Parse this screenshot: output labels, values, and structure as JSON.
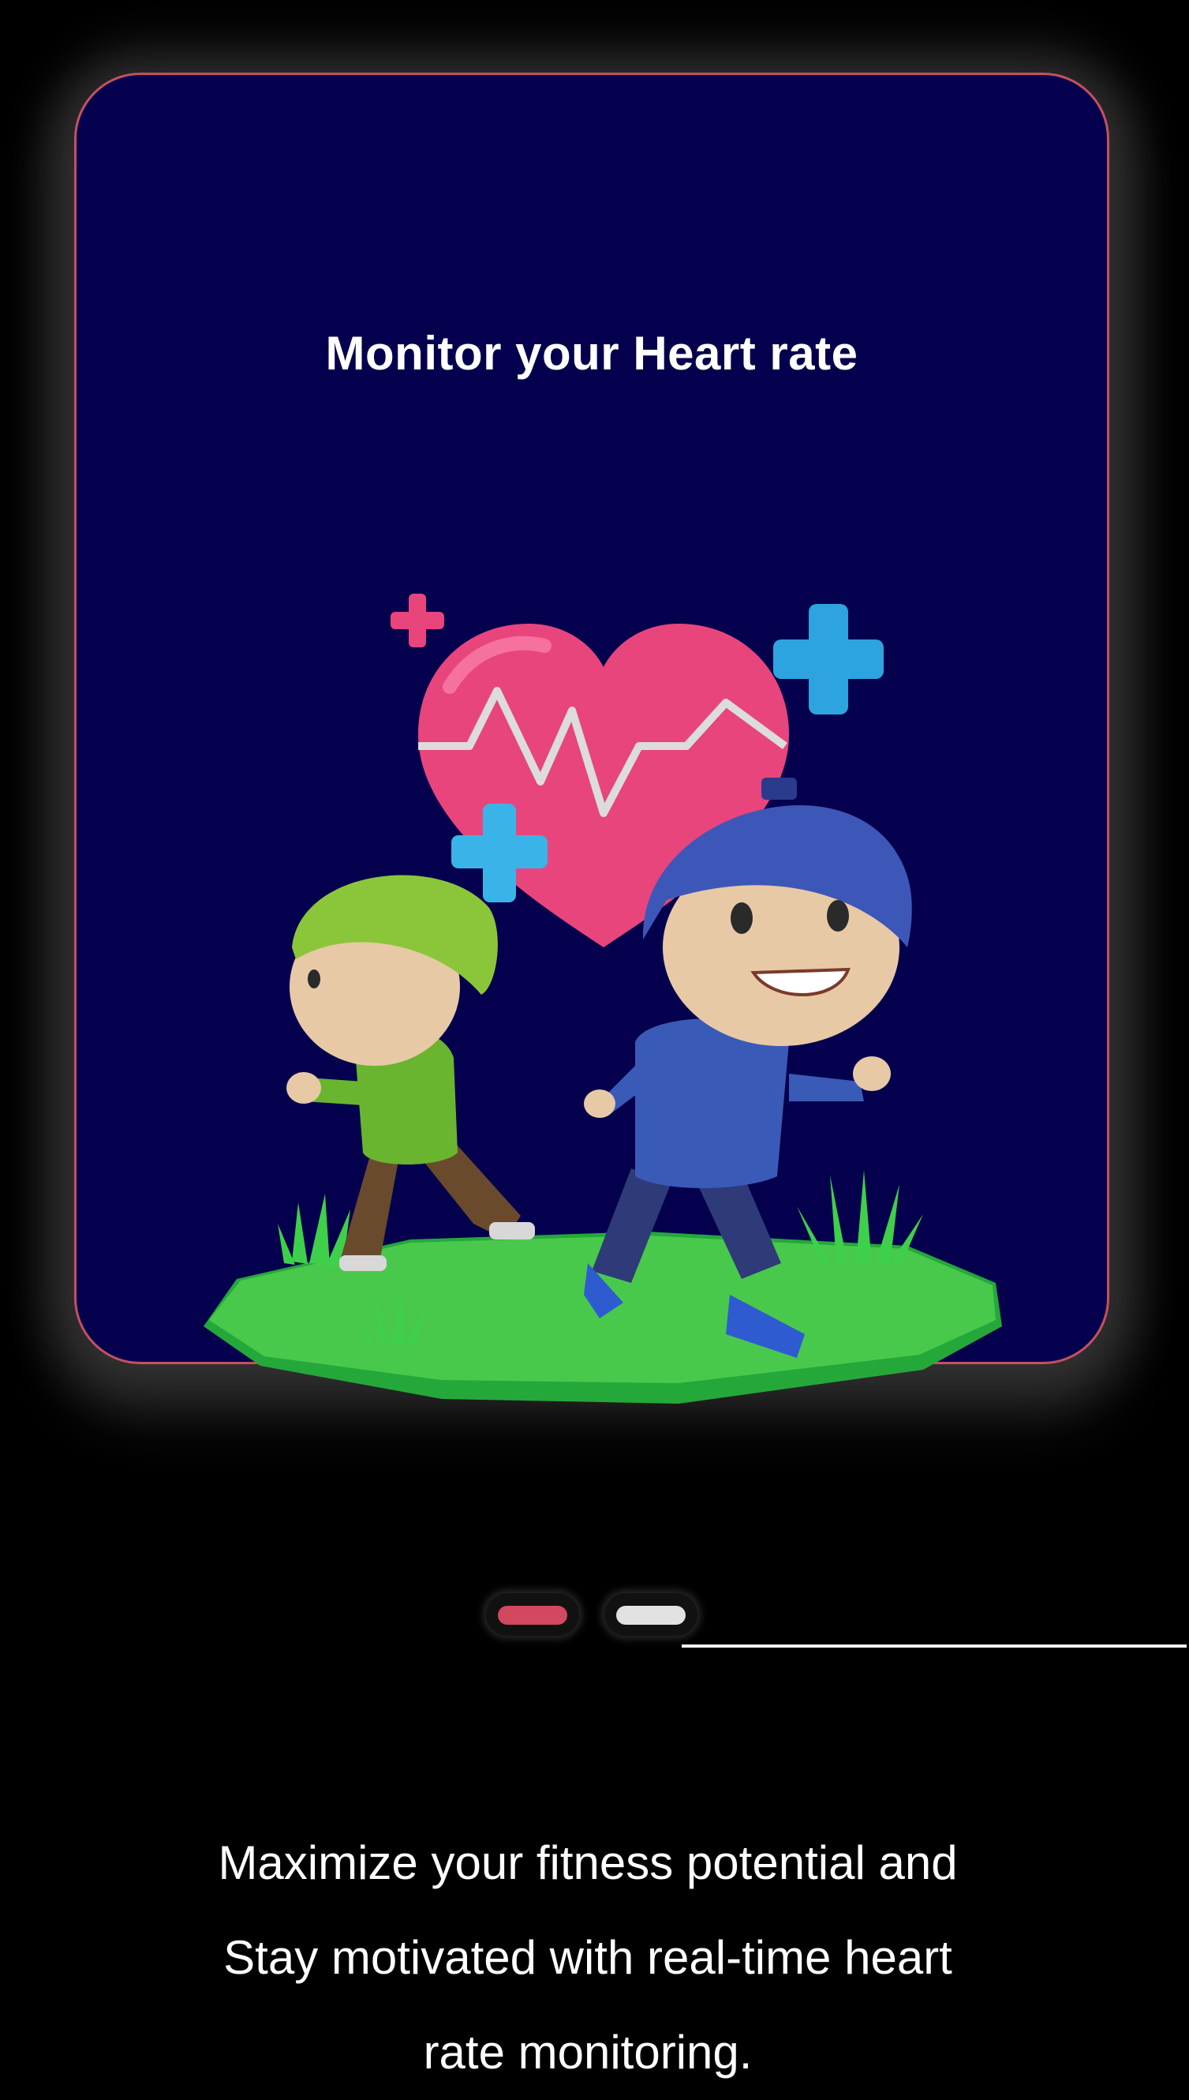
{
  "onboarding": {
    "card_title": "Monitor your Heart rate",
    "illustration": "runners-heart-rate-illustration",
    "pagination": {
      "total": 2,
      "active_index": 0,
      "active_color": "#d2485f",
      "inactive_color": "#e2e2e2"
    },
    "caption_lines": [
      "Maximize your fitness potential and",
      "Stay motivated with real-time heart",
      "rate monitoring."
    ]
  },
  "colors": {
    "card_background": "#04004d",
    "card_border": "#c84f60",
    "page_background": "#000000"
  }
}
